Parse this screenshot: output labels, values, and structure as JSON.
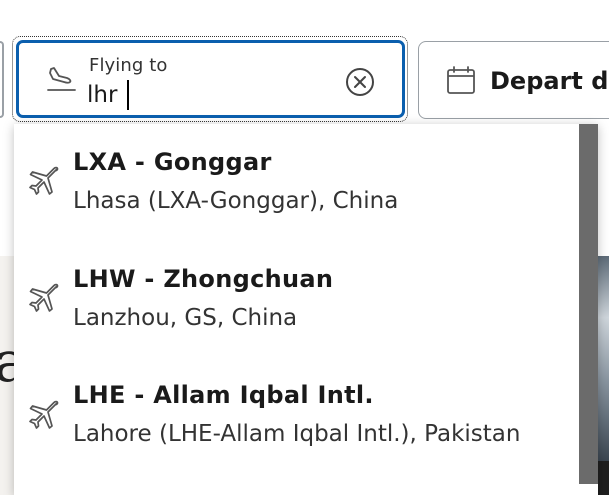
{
  "search": {
    "to_label": "Flying to",
    "to_value": "lhr",
    "depart_label": "Depart da"
  },
  "icons": {
    "destination": "plane-landing-icon",
    "clear": "clear-circle-x-icon",
    "calendar": "calendar-icon",
    "option": "plane-icon"
  },
  "colors": {
    "focus_border": "#0b5fae",
    "scrollbar": "#6b6b6b"
  },
  "suggestions": [
    {
      "code": "LXA - Gonggar",
      "city": "Lhasa (LXA-Gonggar), China"
    },
    {
      "code": "LHW - Zhongchuan",
      "city": "Lanzhou, GS, China"
    },
    {
      "code": "LHE - Allam Iqbal Intl.",
      "city": "Lahore (LHE-Allam Iqbal Intl.), Pakistan"
    }
  ]
}
